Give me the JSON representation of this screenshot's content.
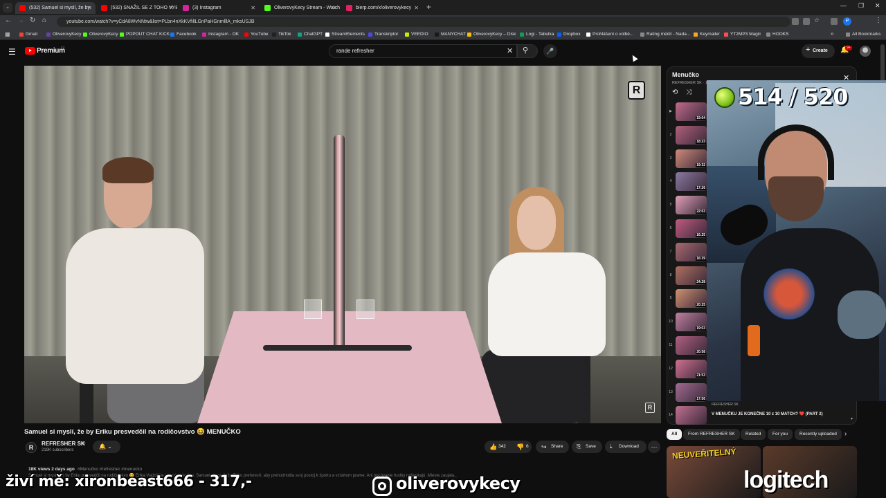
{
  "browser": {
    "tabs": [
      {
        "title": "(532) Samuel si myslí, že by",
        "active": true,
        "favicon_color": "#ff0000"
      },
      {
        "title": "(532) SNAŽIL SE Z TOHO VYB",
        "active": false,
        "favicon_color": "#ff0000"
      },
      {
        "title": "(3) Instagram",
        "active": false,
        "favicon_color": "#d6249f"
      },
      {
        "title": "OliverovyKecy Stream - Watch",
        "active": false,
        "favicon_color": "#53fc18"
      },
      {
        "title": "bierp.com/x/oliverovykecy",
        "active": false,
        "favicon_color": "#e91e63"
      }
    ],
    "url": "youtube.com/watch?v=yCdA8WvNNtw&list=PLbn4nXkKVfillLGnPaHGnmlllA_mksUSJB",
    "profile_initial": "P",
    "bookmarks": [
      {
        "label": "Gmail",
        "color": "#ea4335"
      },
      {
        "label": "OliverovyKecy",
        "color": "#6441a5"
      },
      {
        "label": "OliverovyKecy",
        "color": "#53fc18"
      },
      {
        "label": "POPOUT CHAT KICK",
        "color": "#53fc18"
      },
      {
        "label": "Facebook",
        "color": "#1877f2"
      },
      {
        "label": "Instagram - OK",
        "color": "#d6249f"
      },
      {
        "label": "YouTube",
        "color": "#ff0000"
      },
      {
        "label": "TikTok",
        "color": "#222222"
      },
      {
        "label": "ChatGPT",
        "color": "#10a37f"
      },
      {
        "label": "StreamElements",
        "color": "#ffffff"
      },
      {
        "label": "Transkriptor",
        "color": "#4f46e5"
      },
      {
        "label": "VEEDIO",
        "color": "#c4f000"
      },
      {
        "label": "MANYCHAT",
        "color": "#1a1a1a"
      },
      {
        "label": "OliverovyKecy – Disk",
        "color": "#fbbc04"
      },
      {
        "label": "Logi - Tabulka",
        "color": "#0f9d58"
      },
      {
        "label": "Dropbox",
        "color": "#0061ff"
      },
      {
        "label": "Prohlášení o volbě...",
        "color": "#ffffff"
      },
      {
        "label": "Rating médií - Nada...",
        "color": "#888888"
      },
      {
        "label": "Keymailer",
        "color": "#f5a623"
      },
      {
        "label": "YT2MP3 Magic",
        "color": "#ff4d4d"
      },
      {
        "label": "HOOKS",
        "color": "#888888"
      }
    ],
    "all_bookmarks": "All Bookmarks"
  },
  "header": {
    "logo_text": "Premium",
    "logo_region": "CZ",
    "search_value": "rande refresher",
    "create_label": "Create",
    "notification_count": "9+"
  },
  "video": {
    "title": "Samuel si myslí, že by Eriku presvedčil na rodičovstvo 😆 MENUČKO",
    "brand_mark": "R",
    "channel_name": "REFRESHER SK",
    "channel_subs": "219K subscribers",
    "likes": "342",
    "dislikes": "6",
    "share_label": "Share",
    "save_label": "Save",
    "download_label": "Download",
    "views_date": "18K views  2 days ago",
    "tags": "#Menučko #refresher #menucko",
    "description": "Samuel si myslí, že by Eriku presvedčil na rodičovstvo 😆 Erika Vraždiť je pre nás ako hra. Samuel si myslí, že Eriku prehovorí, aby prehodnotila svoj postoj k športu a vzťahom prame. Ani pocúvanie hudby nešepkajú. Mieste zaujala..."
  },
  "playlist": {
    "title": "Menučko",
    "subtitle": "REFRESHER SK · 1",
    "items": [
      {
        "num": "▶",
        "duration": "19:04",
        "color": "#c06a8a"
      },
      {
        "num": "2",
        "duration": "18:23",
        "color": "#b0607a"
      },
      {
        "num": "3",
        "duration": "19:32",
        "color": "#d08a7a"
      },
      {
        "num": "4",
        "duration": "17:26",
        "color": "#8a7aa0"
      },
      {
        "num": "5",
        "duration": "22:03",
        "color": "#e0a0b8"
      },
      {
        "num": "6",
        "duration": "16:25",
        "color": "#c05a80"
      },
      {
        "num": "7",
        "duration": "16:39",
        "color": "#a86a70"
      },
      {
        "num": "8",
        "duration": "24:28",
        "color": "#b07060"
      },
      {
        "num": "9",
        "duration": "20:25",
        "color": "#d09070"
      },
      {
        "num": "10",
        "duration": "19:03",
        "color": "#c080a0"
      },
      {
        "num": "11",
        "duration": "20:58",
        "color": "#b06080"
      },
      {
        "num": "12",
        "duration": "21:53",
        "color": "#d07090"
      },
      {
        "num": "13",
        "duration": "17:56",
        "color": "#a06a90"
      },
      {
        "num": "14",
        "duration": "",
        "color": "#c07090"
      }
    ],
    "now_channel": "REFRESHER SK",
    "now_title": "V MENUČKU JE KONEČNE 10 z 10 MATCH? ❤️ (PART 2)"
  },
  "chips": [
    "All",
    "From REFRESHER SK",
    "Related",
    "For you",
    "Recently uploaded"
  ],
  "related_thumbs": [
    {
      "text": "NEUVEŘITELNÝ",
      "color": "#7a4a3a"
    },
    {
      "text": "",
      "color": "#5a3a2a"
    }
  ],
  "overlay": {
    "counter": "514 / 520",
    "donate_text": "živí mě: xironbeast666 - 317,-",
    "instagram_handle": "oliverovykecy",
    "sponsor": "logitech"
  }
}
